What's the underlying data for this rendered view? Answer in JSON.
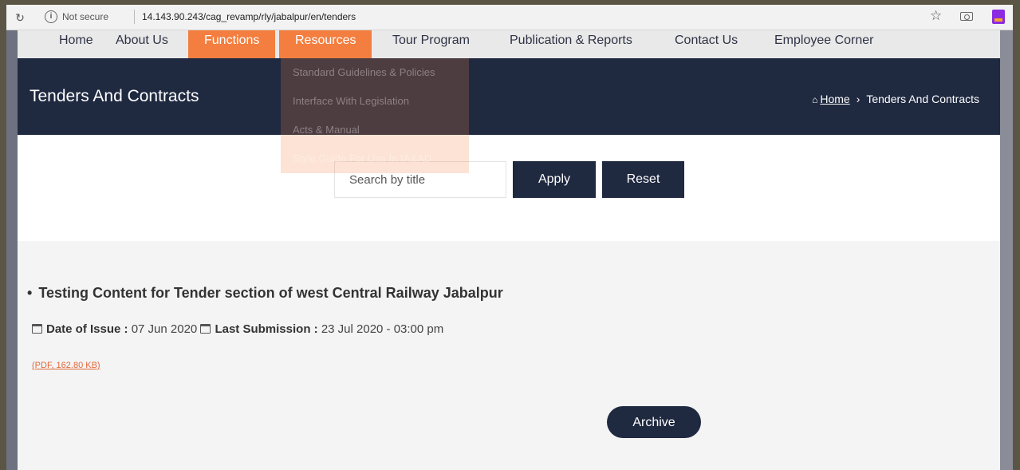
{
  "browser": {
    "security_label": "Not secure",
    "url": "14.143.90.243/cag_revamp/rly/jabalpur/en/tenders"
  },
  "nav": {
    "items": [
      {
        "label": "Home"
      },
      {
        "label": "About Us"
      },
      {
        "label": "Functions",
        "active": true
      },
      {
        "label": "Resources",
        "active": true
      },
      {
        "label": "Tour Program"
      },
      {
        "label": "Publication & Reports"
      },
      {
        "label": "Contact Us"
      },
      {
        "label": "Employee Corner"
      }
    ],
    "dropdown": [
      "Standard Guidelines & Policies",
      "Interface With Legislation",
      "Acts & Manual",
      "Style Guide For Use In IA&AD"
    ]
  },
  "banner": {
    "title": "Tenders And Contracts",
    "breadcrumb_home": "Home",
    "breadcrumb_current": "Tenders And Contracts"
  },
  "search": {
    "placeholder": "Search by title",
    "value": "",
    "apply_label": "Apply",
    "reset_label": "Reset"
  },
  "tender": {
    "title": "Testing Content for Tender section of west Central Railway Jabalpur",
    "issue_label": "Date of Issue :",
    "issue_date": "07 Jun 2020",
    "submission_label": "Last Submission :",
    "submission_date": "23 Jul 2020 - 03:00 pm",
    "file_link": "(PDF, 162.80 KB)"
  },
  "archive_label": "Archive",
  "colors": {
    "navy": "#1f2940",
    "accent": "#f37e3f",
    "link": "#e3683a"
  }
}
